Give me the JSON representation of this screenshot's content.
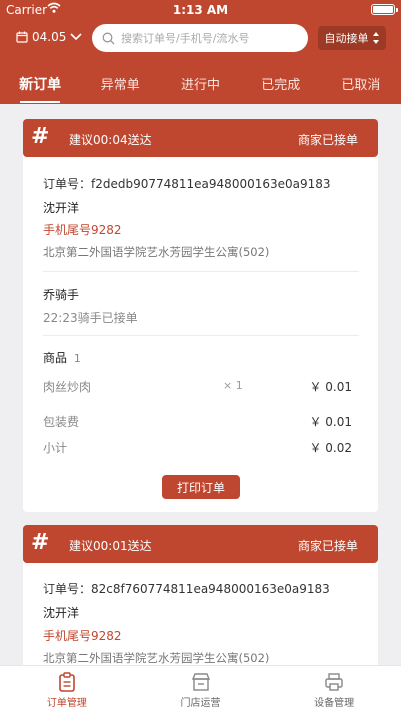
{
  "colors": {
    "accent": "#c0472f",
    "background": "#efeff1"
  },
  "status_bar": {
    "carrier": "Carrier",
    "time": "1:13 AM"
  },
  "toolbar": {
    "date": "04.05",
    "search_placeholder": "搜索订单号/手机号/流水号",
    "auto_accept": "自动接单"
  },
  "tabs": [
    {
      "label": "新订单",
      "active": true
    },
    {
      "label": "异常单"
    },
    {
      "label": "进行中"
    },
    {
      "label": "已完成"
    },
    {
      "label": "已取消"
    }
  ],
  "orders": [
    {
      "hash": "#",
      "eta": "建议00:04送达",
      "status": "商家已接单",
      "order_no": "订单号：f2dedb90774811ea948000163e0a9183",
      "customer": "沈开洋",
      "phone": "手机尾号9282",
      "address": "北京第二外国语学院艺水芳园学生公寓(502)",
      "rider": "乔骑手",
      "rider_note": "22:23骑手已接单",
      "goods_label": "商品",
      "goods_count": "1",
      "items": [
        {
          "name": "肉丝炒肉",
          "qty": "× 1",
          "price": "￥ 0.01"
        }
      ],
      "packing_label": "包装费",
      "packing": "￥ 0.01",
      "subtotal_label": "小计",
      "subtotal": "￥ 0.02",
      "print_label": "打印订单"
    },
    {
      "hash": "#",
      "eta": "建议00:01送达",
      "status": "商家已接单",
      "order_no": "订单号：82c8f760774811ea948000163e0a9183",
      "customer": "沈开洋",
      "phone": "手机尾号9282",
      "address": "北京第二外国语学院艺水芳园学生公寓(502)"
    }
  ],
  "bottom_nav": [
    {
      "label": "订单管理",
      "icon": "clipboard-icon",
      "active": true
    },
    {
      "label": "门店运营",
      "icon": "store-icon"
    },
    {
      "label": "设备管理",
      "icon": "printer-icon"
    }
  ]
}
